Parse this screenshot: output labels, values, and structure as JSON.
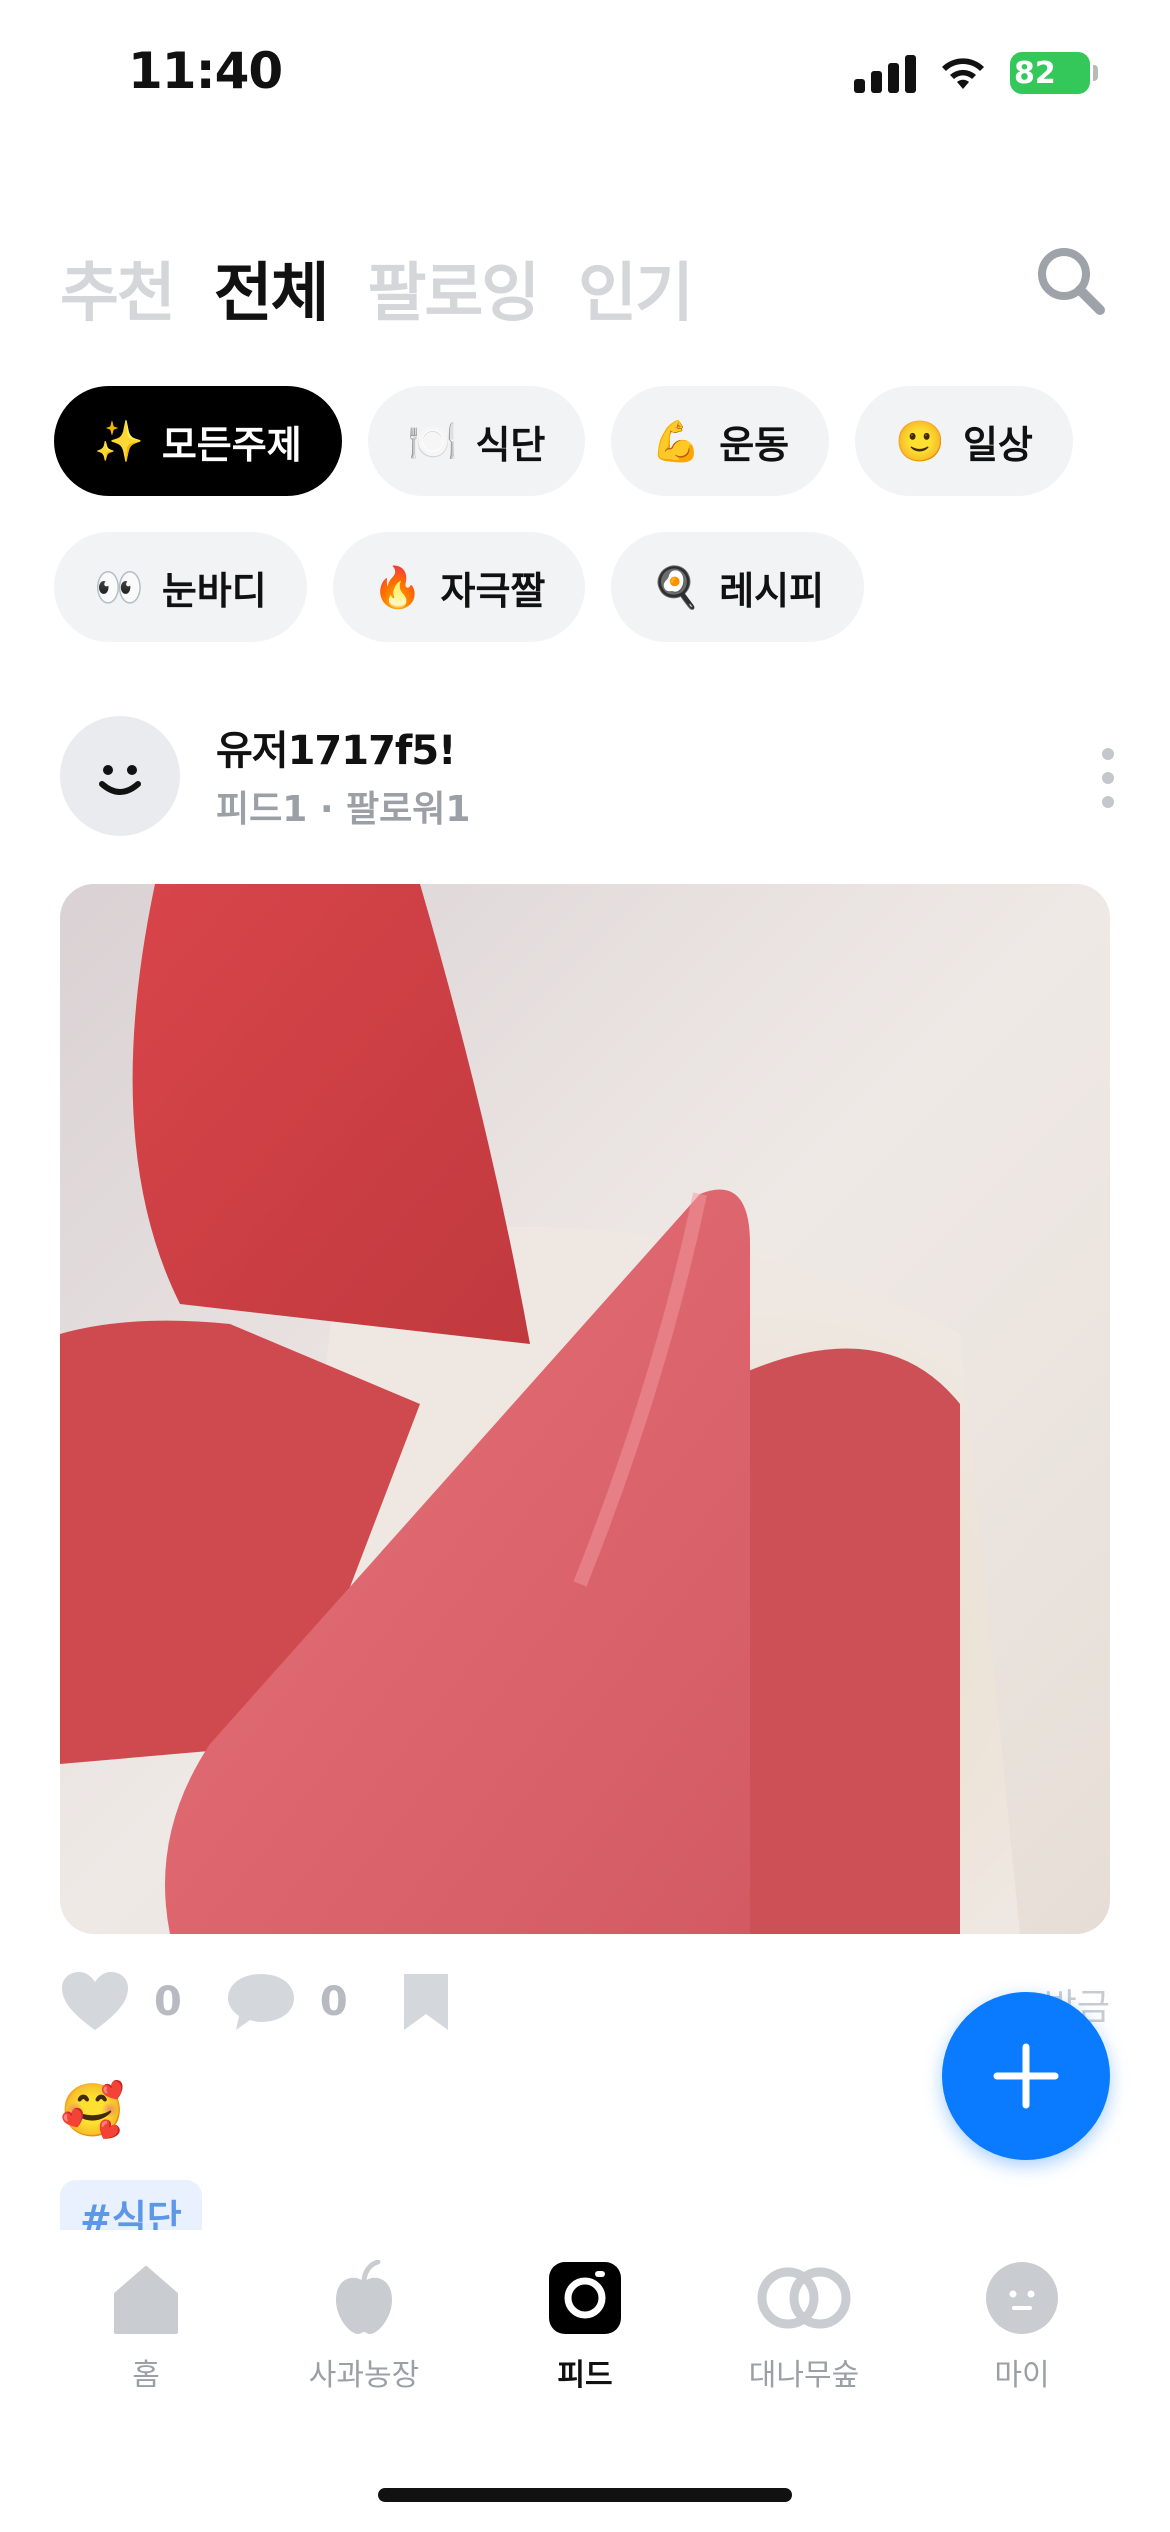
{
  "status_bar": {
    "time": "11:40",
    "battery": "82"
  },
  "tabs": [
    {
      "label": "추천"
    },
    {
      "label": "전체"
    },
    {
      "label": "팔로잉"
    },
    {
      "label": "인기"
    }
  ],
  "chips": [
    {
      "emoji": "✨",
      "label": "모든주제"
    },
    {
      "emoji": "🍽️",
      "label": "식단"
    },
    {
      "emoji": "💪",
      "label": "운동"
    },
    {
      "emoji": "🙂",
      "label": "일상"
    },
    {
      "emoji": "👀",
      "label": "눈바디"
    },
    {
      "emoji": "🔥",
      "label": "자극짤"
    },
    {
      "emoji": "🍳",
      "label": "레시피"
    }
  ],
  "post": {
    "username": "유저1717f5!",
    "meta": "피드1 · 팔로워1",
    "likes": "0",
    "comments": "0",
    "time_ago": "방금",
    "emoji_line": "🥰",
    "hashtag": "#식단"
  },
  "bottom_nav": [
    {
      "label": "홈"
    },
    {
      "label": "사과농장"
    },
    {
      "label": "피드"
    },
    {
      "label": "대나무숲"
    },
    {
      "label": "마이"
    }
  ]
}
